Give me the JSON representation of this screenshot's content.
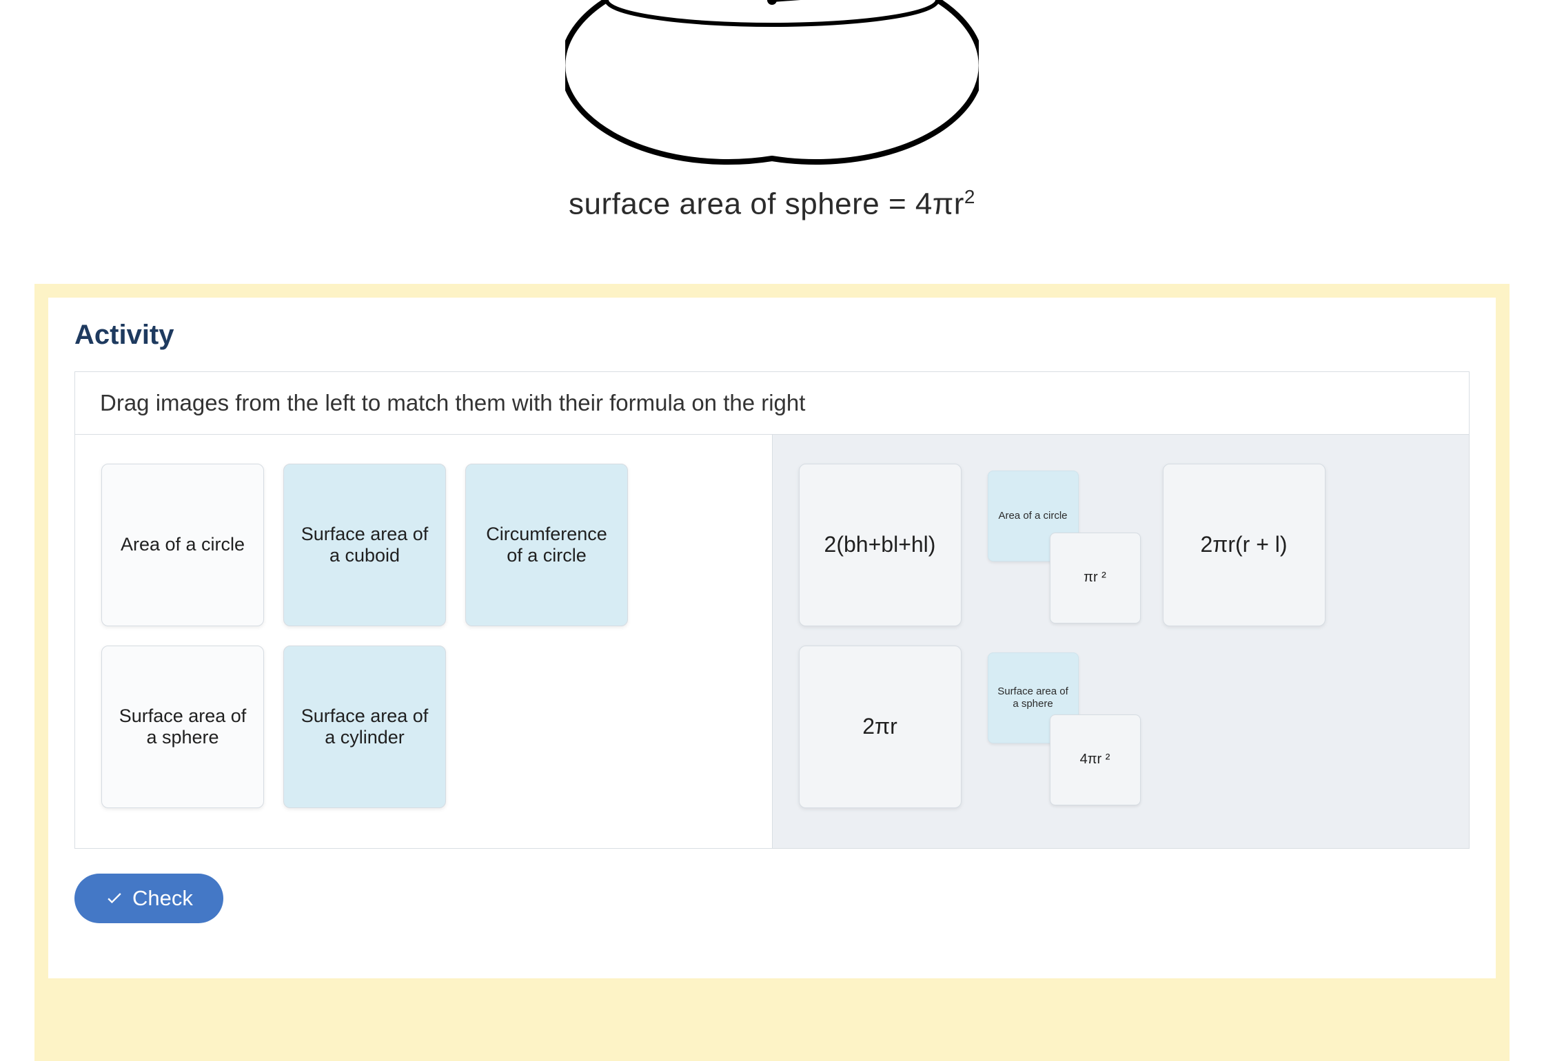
{
  "diagram": {
    "formula_prefix": "surface area of sphere = 4πr",
    "formula_sup": "2"
  },
  "activity": {
    "title": "Activity",
    "instruction": "Drag images from the left to match them with their formula on the right",
    "left_cards": [
      {
        "label": "Area of a circle",
        "style": "plain"
      },
      {
        "label": "Surface area of a cuboid",
        "style": "blue"
      },
      {
        "label": "Circumference of a circle",
        "style": "blue"
      },
      {
        "label": "Surface area of a sphere",
        "style": "plain"
      },
      {
        "label": "Surface area of a cylinder",
        "style": "blue"
      }
    ],
    "right_items": [
      {
        "type": "drop",
        "label": "2(bh+bl+hl)"
      },
      {
        "type": "matched",
        "shape_label": "Area of a circle",
        "formula": "πr ²"
      },
      {
        "type": "drop",
        "label": "2πr(r + l)"
      },
      {
        "type": "drop",
        "label": "2πr"
      },
      {
        "type": "matched",
        "shape_label": "Surface area of a sphere",
        "formula": "4πr ²"
      }
    ],
    "check_label": "Check"
  }
}
